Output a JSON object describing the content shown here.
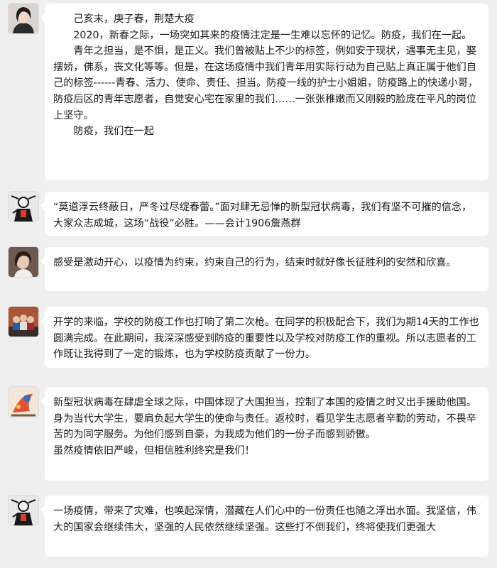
{
  "conversation": {
    "messages": [
      {
        "avatar_icon": "portrait-photo",
        "paragraphs": [
          "己亥末，庚子春，荆楚大疫",
          "2020，新春之际，一场突如其来的疫情注定是一生难以忘怀的记忆。防疫，我们在一起。",
          "青年之担当，是不惧，是正义。我们曾被贴上不少的标签，例如安于现状，遇事无主见，娶摆娇，佛系，丧文化等等。但是，在这场疫情中我们青年用实际行动为自己贴上真正属于他们自己的标签------青春、活力、使命、责任、担当。防疫一线的护士小姐姐，防疫路上的快递小哥，防疫后区的青年志愿者，自觉安心宅在家里的我们……一张张稚嫩而又刚毅的脸庞在平凡的岗位上坚守。",
          "防疫，我们在一起"
        ]
      },
      {
        "avatar_icon": "comic-art-avatar",
        "paragraphs": [
          "“莫道浮云终蔽日，严冬过尽绽春蕾。”面对肆无忌惮的新型冠状病毒，我们有坚不可摧的信念，大家众志成城，这场“战役”必胜。——会计1906詹燕群"
        ]
      },
      {
        "avatar_icon": "girl-photo-avatar",
        "paragraphs": [
          "感受是激动开心，以疫情为约束，约束自己的行为，结束时就好像长征胜利的安然和欣喜。"
        ]
      },
      {
        "avatar_icon": "group-photo-avatar",
        "paragraphs": [
          "开学的来临，学校的防疫工作也打响了第二次枪。在同学的积极配合下，我们为期14天的工作也圆满完成。在此期间，我深深感受到防疫的重要性以及学校对防疫工作的重视。所以志愿者的工作既让我得到了一定的锻炼，也为学校防疫贡献了一份力。"
        ]
      },
      {
        "avatar_icon": "cartoon-avatar",
        "paragraphs": [
          "新型冠状病毒在肆虐全球之际，中国体现了大国担当，控制了本国的疫情之时又出手援助他国。身为当代大学生，要肩负起大学生的使命与责任。返校时，看见学生志愿者辛勤的劳动，不畏辛苦的为同学服务。为他们感到自豪，为我成为他们的一份子而感到骄傲。",
          "虽然疫情依旧严峻，但相信胜利终究是我们！"
        ]
      },
      {
        "avatar_icon": "comic-art-avatar",
        "paragraphs": [
          "一场疫情，带来了灾难，也唤起深情，潜藏在人们心中的一份责任也随之浮出水面。我坚信，伟大的国家会继续伟大，坚强的人民依然继续坚强。这些打不倒我们，终将使我们更强大"
        ]
      }
    ]
  },
  "colors": {
    "background": "#efefef",
    "bubble": "#ffffff",
    "text": "#1a1a1a"
  }
}
